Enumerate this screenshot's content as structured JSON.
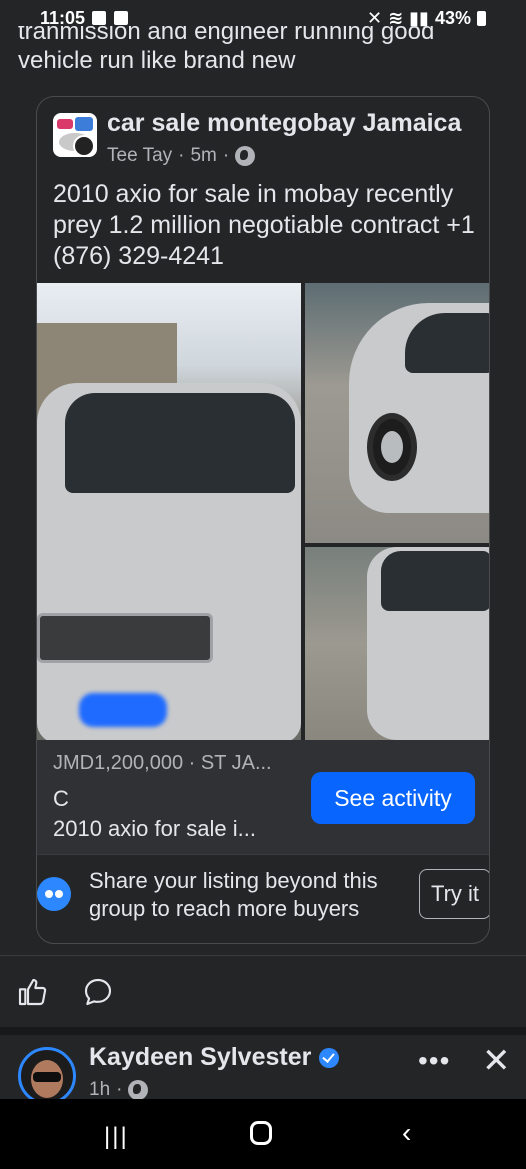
{
  "status_bar": {
    "time": "11:05",
    "battery": "43%"
  },
  "post": {
    "text_cut": "tranmission and engineer running good",
    "text_line2": "vehicle run like brand new"
  },
  "shared_post": {
    "group_name": "car sale montegobay Jamaica",
    "author": "Tee Tay",
    "time": "5m",
    "meta_separator": " · ",
    "listing_text": "2010 axio for sale in mobay recently prey 1.2 million  negotiable contract +1 (876) 329-4241",
    "price": "JMD1,200,000 · ST JA...",
    "condition": "C",
    "title": "2010 axio for  sale i...",
    "see_activity_label": "See activity",
    "share_text": "Share your listing beyond this group to reach more buyers",
    "try_label": "Try it"
  },
  "next_post": {
    "name": "Kaydeen Sylvester",
    "time": "1h",
    "more_label": "•••",
    "close_label": "✕"
  },
  "nav": {
    "recent": "|||",
    "back": "‹"
  },
  "colors": {
    "background": "#242526",
    "accent_blue": "#0866ff",
    "text_primary": "#e4e6eb",
    "text_secondary": "#b0b3b8"
  }
}
